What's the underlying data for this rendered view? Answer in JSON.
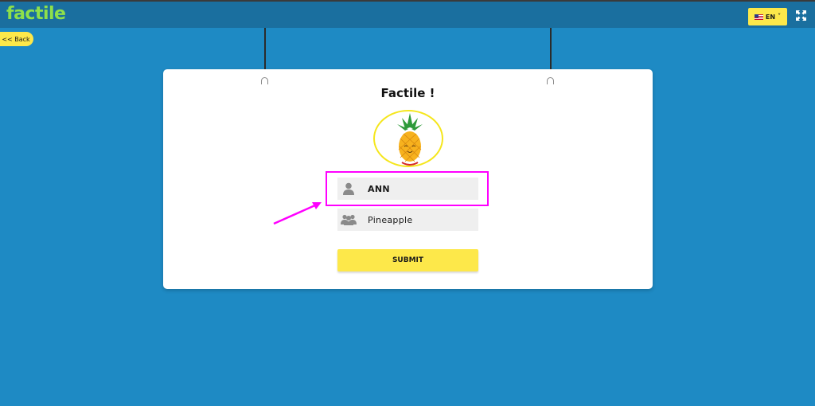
{
  "header": {
    "logo": "factile",
    "language": "EN",
    "icons": {
      "flag": "us-flag-icon",
      "chevron": "chevron-down-icon",
      "fullscreen": "fullscreen-icon"
    }
  },
  "nav": {
    "back_label": "<< Back"
  },
  "card": {
    "title": "Factile !",
    "avatar": "pineapple-avatar",
    "player_name": "ANN",
    "team_name": "Pineapple",
    "submit_label": "SUBMIT"
  },
  "annotation": {
    "color": "#ff00ff"
  },
  "colors": {
    "background": "#1e8ac4",
    "topbar": "#1a6f9f",
    "accent": "#fde84a",
    "logo": "#8ee04a"
  }
}
